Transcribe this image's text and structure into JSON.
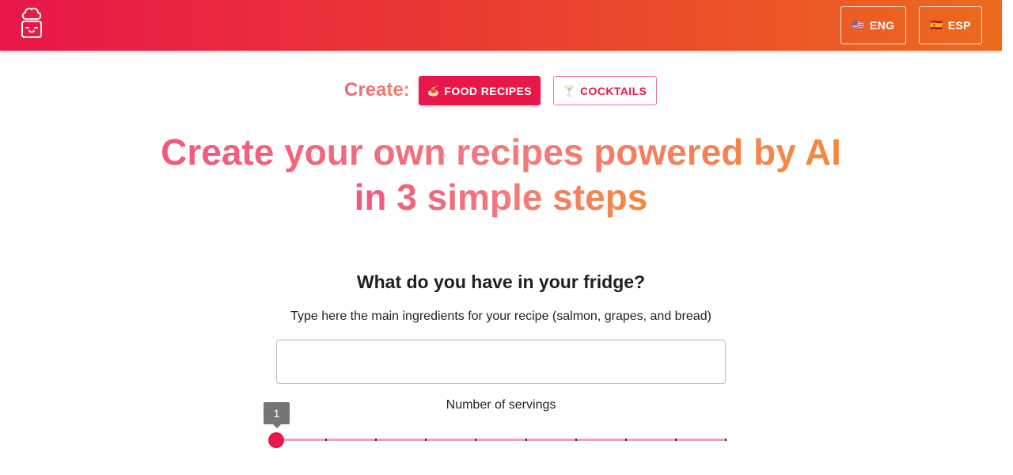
{
  "header": {
    "logo_icon": "chef-robot-icon",
    "languages": [
      {
        "flag": "🇺🇸",
        "label": "ENG"
      },
      {
        "flag": "🇪🇸",
        "label": "ESP"
      }
    ]
  },
  "create": {
    "label": "Create:",
    "modes": [
      {
        "icon": "🍝",
        "label": "FOOD RECIPES",
        "selected": true
      },
      {
        "icon": "🍸",
        "label": "COCKTAILS",
        "selected": false
      }
    ]
  },
  "hero": {
    "line1": "Create your own recipes powered by AI",
    "line2": "in 3 simple steps"
  },
  "fridge": {
    "title": "What do you have in your fridge?",
    "subtitle": "Type here the main ingredients for your recipe (salmon, grapes, and bread)",
    "input_value": "",
    "input_placeholder": ""
  },
  "servings": {
    "label": "Number of servings",
    "value": 1,
    "value_text": "1",
    "min": 1,
    "max": 10
  },
  "colors": {
    "primary": "#e8174a",
    "header_gradient_start": "#e8174a",
    "header_gradient_end": "#ec6a1e",
    "slider_rail": "#f3a0b4"
  }
}
